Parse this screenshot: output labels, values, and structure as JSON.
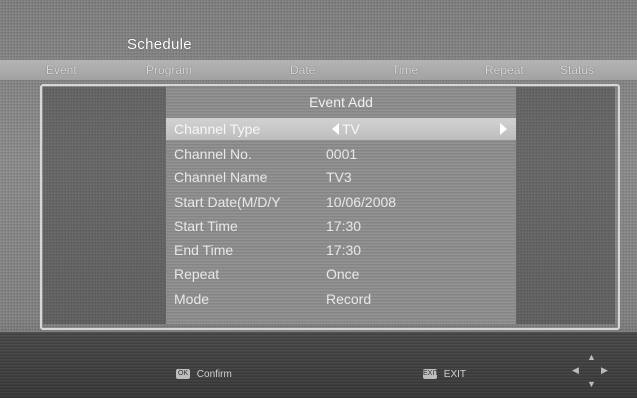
{
  "screen": {
    "title": "Schedule",
    "columns": [
      "Event",
      "Program",
      "Date",
      "Time",
      "Repeat",
      "Status"
    ]
  },
  "dialog": {
    "title": "Event Add",
    "fields": [
      {
        "label": "Channel Type",
        "value": "TV"
      },
      {
        "label": "Channel No.",
        "value": "0001"
      },
      {
        "label": "Channel Name",
        "value": "TV3"
      },
      {
        "label": "Start Date(M/D/Y",
        "value": "10/06/2008"
      },
      {
        "label": "Start Time",
        "value": "17:30"
      },
      {
        "label": "End Time",
        "value": "17:30"
      },
      {
        "label": "Repeat",
        "value": "Once"
      },
      {
        "label": "Mode",
        "value": "Record"
      }
    ]
  },
  "footer": {
    "confirm": {
      "key": "OK",
      "label": "Confirm"
    },
    "exit": {
      "key": "EXIT",
      "label": "EXIT"
    }
  },
  "navpad_icons": [
    "arrow-up-icon",
    "arrow-down-icon",
    "arrow-left-icon",
    "arrow-right-icon"
  ],
  "colors": {
    "background": "#858585",
    "highlight": "#c8c8c8",
    "text": "#ffffff"
  }
}
